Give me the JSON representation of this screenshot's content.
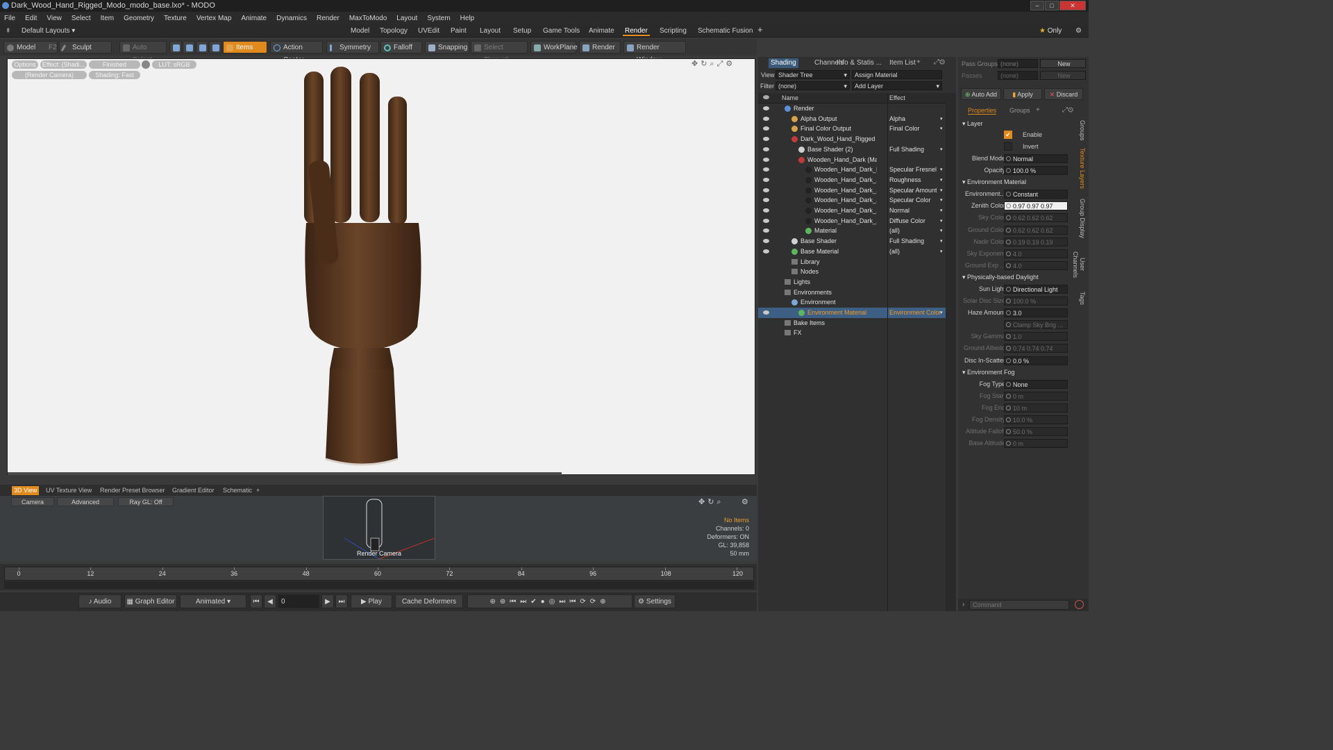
{
  "window": {
    "title": "Dark_Wood_Hand_Rigged_Modo_modo_base.lxo* - MODO"
  },
  "menu": [
    "File",
    "Edit",
    "View",
    "Select",
    "Item",
    "Geometry",
    "Texture",
    "Vertex Map",
    "Animate",
    "Dynamics",
    "Render",
    "MaxToModo",
    "Layout",
    "System",
    "Help"
  ],
  "layouts": {
    "selector": "Default Layouts",
    "tabs": [
      "Model",
      "Topology",
      "UVEdit",
      "Paint",
      "Layout",
      "Setup",
      "Game Tools",
      "Animate",
      "Render",
      "Scripting",
      "Schematic Fusion"
    ],
    "active": "Render",
    "only": "Only"
  },
  "toolbar": {
    "model": "Model",
    "model_key": "F2",
    "sculpt": "Sculpt",
    "auto_select": "Auto Select",
    "items": "Items",
    "action_center": "Action Center",
    "symmetry": "Symmetry",
    "falloff": "Falloff",
    "snapping": "Snapping",
    "select_through": "Select Through",
    "workplane": "WorkPlane",
    "render": "Render",
    "render_window": "Render Window"
  },
  "viewport": {
    "options": "Options",
    "effect": "Effect: (Shadi...",
    "finished": "Finished",
    "lut": "LUT: sRGB",
    "render_camera": "(Render Camera)",
    "shading": "Shading: Fast"
  },
  "bottom_tabs": [
    "3D View",
    "UV Texture View",
    "Render Preset Browser",
    "Gradient Editor",
    "Schematic"
  ],
  "camera_bar": {
    "camera": "Camera",
    "advanced": "Advanced",
    "raygl": "Ray GL: Off"
  },
  "camera_info": {
    "label": "Render Camera",
    "no_items": "No Items",
    "channels": "Channels: 0",
    "deformers": "Deformers: ON",
    "gl": "GL: 39,858",
    "mm": "50 mm"
  },
  "timeline": {
    "ticks": [
      "0",
      "12",
      "24",
      "36",
      "48",
      "60",
      "72",
      "84",
      "96",
      "108",
      "120"
    ],
    "sub": [
      "0",
      "120",
      "120"
    ]
  },
  "transport": {
    "audio": "Audio",
    "graph_editor": "Graph Editor",
    "animated": "Animated",
    "frame": "0",
    "play": "Play",
    "cache": "Cache Deformers",
    "settings": "Settings"
  },
  "shading": {
    "tabs": [
      "Shading",
      "Channels",
      "Info & Statis ...",
      "Item List"
    ],
    "view_label": "View",
    "view_value": "Shader Tree",
    "assign": "Assign Material",
    "filter_label": "Filter",
    "filter_value": "(none)",
    "add_layer": "Add Layer",
    "col_name": "Name",
    "col_effect": "Effect",
    "rows": [
      {
        "name": "Render",
        "effect": "",
        "indent": 0,
        "color": "#5b8fd6"
      },
      {
        "name": "Alpha Output",
        "effect": "Alpha",
        "indent": 1,
        "color": "#d6a24a"
      },
      {
        "name": "Final Color Output",
        "effect": "Final Color",
        "indent": 1,
        "color": "#d6a24a"
      },
      {
        "name": "Dark_Wood_Hand_Rigged",
        "effect": "",
        "indent": 1,
        "color": "#c23a3a"
      },
      {
        "name": "Base Shader (2)",
        "effect": "Full Shading",
        "indent": 2,
        "color": "#d0d0d0"
      },
      {
        "name": "Wooden_Hand_Dark (Ma...",
        "effect": "",
        "indent": 2,
        "color": "#c23a3a"
      },
      {
        "name": "Wooden_Hand_Dark_I...",
        "effect": "Specular Fresnel",
        "indent": 3,
        "color": "#222"
      },
      {
        "name": "Wooden_Hand_Dark_...",
        "effect": "Roughness",
        "indent": 3,
        "color": "#222"
      },
      {
        "name": "Wooden_Hand_Dark_...",
        "effect": "Specular Amount",
        "indent": 3,
        "color": "#222"
      },
      {
        "name": "Wooden_Hand_Dark_...",
        "effect": "Specular Color",
        "indent": 3,
        "color": "#222"
      },
      {
        "name": "Wooden_Hand_Dark_...",
        "effect": "Normal",
        "indent": 3,
        "color": "#222"
      },
      {
        "name": "Wooden_Hand_Dark_...",
        "effect": "Diffuse Color",
        "indent": 3,
        "color": "#222"
      },
      {
        "name": "Material",
        "effect": "(all)",
        "indent": 3,
        "color": "#5fb55f"
      },
      {
        "name": "Base Shader",
        "effect": "Full Shading",
        "indent": 1,
        "color": "#d0d0d0"
      },
      {
        "name": "Base Material",
        "effect": "(all)",
        "indent": 1,
        "color": "#5fb55f"
      },
      {
        "name": "Library",
        "effect": "",
        "indent": 1,
        "color": ""
      },
      {
        "name": "Nodes",
        "effect": "",
        "indent": 1,
        "color": ""
      },
      {
        "name": "Lights",
        "effect": "",
        "indent": 0,
        "color": ""
      },
      {
        "name": "Environments",
        "effect": "",
        "indent": 0,
        "color": ""
      },
      {
        "name": "Environment",
        "effect": "",
        "indent": 1,
        "color": "#7aa9d6"
      },
      {
        "name": "Environment Material",
        "effect": "Environment Color",
        "indent": 2,
        "color": "#5fb55f",
        "selected": true
      },
      {
        "name": "Bake Items",
        "effect": "",
        "indent": 0,
        "color": ""
      },
      {
        "name": "FX",
        "effect": "",
        "indent": 0,
        "color": ""
      }
    ]
  },
  "props": {
    "pass_groups": "Pass Groups",
    "pass_groups_value": "(none)",
    "new": "New",
    "passes": "Passes",
    "passes_value": "(none)",
    "auto_add": "Auto Add",
    "apply": "Apply",
    "discard": "Discard",
    "tab_properties": "Properties",
    "tab_groups": "Groups",
    "section_layer": "Layer",
    "enable": "Enable",
    "invert": "Invert",
    "fields": [
      {
        "label": "Blend Mode",
        "value": "Normal",
        "dim": false
      },
      {
        "label": "Opacity",
        "value": "100.0 %",
        "dim": false
      },
      {
        "section": "Environment Material"
      },
      {
        "label": "Environment...",
        "value": "Constant",
        "dim": false
      },
      {
        "label": "Zenith Color",
        "value": "0.97  0.97  0.97",
        "dim": false,
        "white": true
      },
      {
        "label": "Sky Color",
        "value": "0.62  0.62  0.62",
        "dim": true
      },
      {
        "label": "Ground Color",
        "value": "0.62  0.62  0.62",
        "dim": true
      },
      {
        "label": "Nadir Color",
        "value": "0.19  0.19  0.19",
        "dim": true
      },
      {
        "label": "Sky Exponent",
        "value": "4.0",
        "dim": true
      },
      {
        "label": "Ground Exp ...",
        "value": "4.0",
        "dim": true
      },
      {
        "section": "Physically-based Daylight"
      },
      {
        "label": "Sun Light",
        "value": "Directional Light",
        "dim": false
      },
      {
        "label": "Solar Disc Size",
        "value": "100.0 %",
        "dim": true
      },
      {
        "label": "Haze Amount",
        "value": "3.0",
        "dim": false
      },
      {
        "label": "",
        "value": "Clamp Sky Brig ...",
        "dim": true
      },
      {
        "label": "Sky Gamma",
        "value": "1.0",
        "dim": true
      },
      {
        "label": "Ground Albedo",
        "value": "0.74  0.74  0.74",
        "dim": true
      },
      {
        "label": "Disc In-Scatter",
        "value": "0.0 %",
        "dim": false
      },
      {
        "section": "Environment Fog"
      },
      {
        "label": "Fog Type",
        "value": "None",
        "dim": false
      },
      {
        "label": "Fog Start",
        "value": "0 m",
        "dim": true
      },
      {
        "label": "Fog End",
        "value": "10 m",
        "dim": true
      },
      {
        "label": "Fog Density",
        "value": "10.0 %",
        "dim": true
      },
      {
        "label": "Altitude Falloff",
        "value": "50.0 %",
        "dim": true
      },
      {
        "label": "Base Altitude",
        "value": "0 m",
        "dim": true
      }
    ],
    "command_placeholder": "Command",
    "side_tabs": [
      "Groups",
      "Texture Layers",
      "Group Display",
      "User Channels",
      "Tags"
    ]
  },
  "colors": {
    "accent": "#e28a1c",
    "selection": "#3d5f84"
  }
}
